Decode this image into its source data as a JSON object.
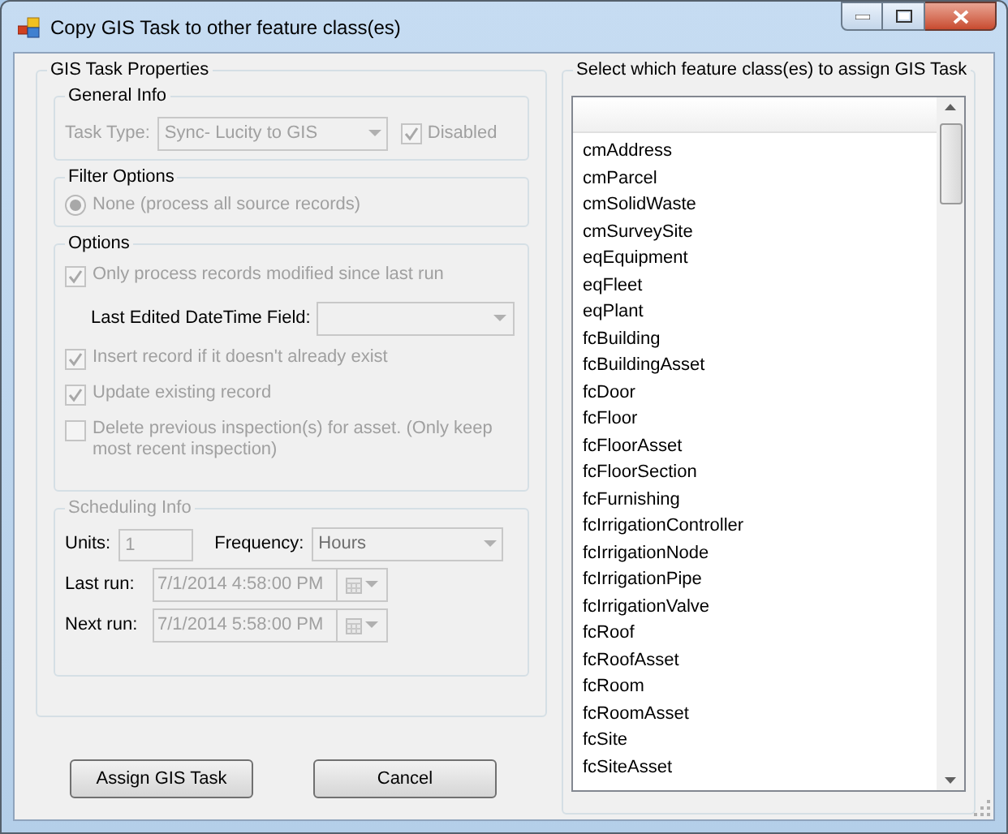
{
  "window": {
    "title": "Copy GIS Task to other feature class(es)"
  },
  "properties": {
    "title": "GIS Task Properties",
    "general": {
      "title": "General Info",
      "task_type_label": "Task Type:",
      "task_type_value": "Sync- Lucity to GIS",
      "disabled_checkbox": {
        "label": "Disabled",
        "checked": true
      }
    },
    "filter": {
      "title": "Filter Options",
      "radio": {
        "label": "None (process all source records)",
        "selected": true
      }
    },
    "options": {
      "title": "Options",
      "items": [
        {
          "kind": "checkbox",
          "label": "Only process records modified since last run",
          "checked": true
        },
        {
          "kind": "dropdown",
          "label": "Last Edited DateTime Field:"
        },
        {
          "kind": "checkbox",
          "label": "Insert record if it doesn't already exist",
          "checked": true
        },
        {
          "kind": "checkbox",
          "label": "Update existing record",
          "checked": true
        },
        {
          "kind": "checkbox",
          "label": "Delete previous inspection(s) for asset.  (Only keep most recent inspection)",
          "checked": false
        }
      ]
    },
    "scheduling": {
      "title": "Scheduling Info",
      "units_label": "Units:",
      "units_value": "1",
      "frequency_label": "Frequency:",
      "frequency_value": "Hours",
      "last_run_label": "Last run:",
      "last_run_value": "7/1/2014 4:58:00 PM",
      "next_run_label": "Next run:",
      "next_run_value": "7/1/2014 5:58:00 PM"
    }
  },
  "feature_classes": {
    "title": "Select which feature class(es) to assign GIS Task",
    "items": [
      "cmAddress",
      "cmParcel",
      "cmSolidWaste",
      "cmSurveySite",
      "eqEquipment",
      "eqFleet",
      "eqPlant",
      "fcBuilding",
      "fcBuildingAsset",
      "fcDoor",
      "fcFloor",
      "fcFloorAsset",
      "fcFloorSection",
      "fcFurnishing",
      "fcIrrigationController",
      "fcIrrigationNode",
      "fcIrrigationPipe",
      "fcIrrigationValve",
      "fcRoof",
      "fcRoofAsset",
      "fcRoom",
      "fcRoomAsset",
      "fcSite",
      "fcSiteAsset"
    ]
  },
  "buttons": [
    {
      "label": "Assign GIS Task"
    },
    {
      "label": "Cancel"
    }
  ]
}
